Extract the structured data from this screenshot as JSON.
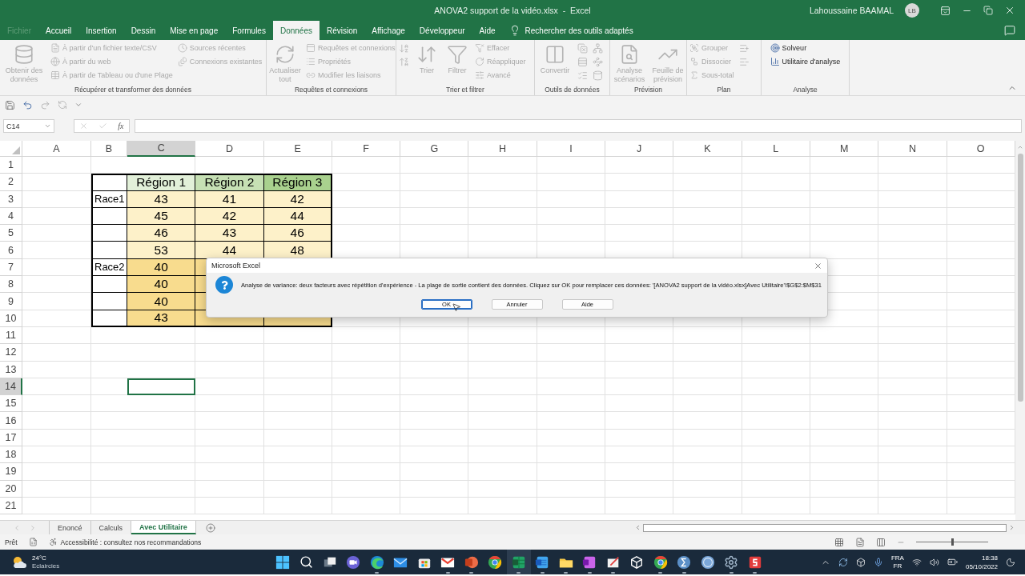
{
  "window": {
    "title": "ANOVA2 support de la vidéo.xlsx  -  Excel",
    "user": "Lahoussaine BAAMAL",
    "avatar": "LB"
  },
  "menu_tabs": [
    {
      "label": "Fichier",
      "selected": false,
      "disabled": true
    },
    {
      "label": "Accueil",
      "selected": false,
      "disabled": false
    },
    {
      "label": "Insertion",
      "selected": false,
      "disabled": false
    },
    {
      "label": "Dessin",
      "selected": false,
      "disabled": false
    },
    {
      "label": "Mise en page",
      "selected": false,
      "disabled": false
    },
    {
      "label": "Formules",
      "selected": false,
      "disabled": false
    },
    {
      "label": "Données",
      "selected": true,
      "disabled": false
    },
    {
      "label": "Révision",
      "selected": false,
      "disabled": false
    },
    {
      "label": "Affichage",
      "selected": false,
      "disabled": false
    },
    {
      "label": "Développeur",
      "selected": false,
      "disabled": false
    },
    {
      "label": "Aide",
      "selected": false,
      "disabled": false
    }
  ],
  "tell_me": "Rechercher des outils adaptés",
  "ribbon_groups": [
    {
      "title": "Récupérer et transformer des données",
      "columns": [
        {
          "kind": "large",
          "items": [
            {
              "label": "Obtenir des données",
              "disabled": true
            }
          ]
        },
        {
          "kind": "stack",
          "items": [
            {
              "label": "À partir d'un fichier texte/CSV",
              "disabled": true
            },
            {
              "label": "À partir du web",
              "disabled": true
            },
            {
              "label": "À partir de Tableau ou d'une Plage",
              "disabled": true
            }
          ]
        },
        {
          "kind": "stack",
          "items": [
            {
              "label": "Sources récentes",
              "disabled": true
            },
            {
              "label": "Connexions existantes",
              "disabled": true
            }
          ]
        }
      ]
    },
    {
      "title": "Requêtes et connexions",
      "columns": [
        {
          "kind": "large",
          "items": [
            {
              "label": "Actualiser tout",
              "disabled": true
            }
          ]
        },
        {
          "kind": "stack",
          "items": [
            {
              "label": "Requêtes et connexions",
              "disabled": true
            },
            {
              "label": "Propriétés",
              "disabled": true
            },
            {
              "label": "Modifier les liaisons",
              "disabled": true
            }
          ]
        }
      ]
    },
    {
      "title": "Trier et filtrer",
      "columns": [
        {
          "kind": "stack",
          "items": [
            {
              "disabled": true
            },
            {
              "disabled": true
            }
          ]
        },
        {
          "kind": "large",
          "items": [
            {
              "label": "Trier",
              "disabled": true
            }
          ]
        },
        {
          "kind": "large",
          "items": [
            {
              "label": "Filtrer",
              "disabled": true
            }
          ]
        },
        {
          "kind": "stack",
          "items": [
            {
              "label": "Effacer",
              "disabled": true
            },
            {
              "label": "Réappliquer",
              "disabled": true
            },
            {
              "label": "Avancé",
              "disabled": true
            }
          ]
        }
      ]
    },
    {
      "title": "Outils de données",
      "columns": [
        {
          "kind": "large",
          "items": [
            {
              "label": "Convertir",
              "disabled": true
            }
          ]
        },
        {
          "kind": "stack",
          "items": [
            {
              "disabled": true
            },
            {
              "disabled": true
            },
            {
              "disabled": true
            }
          ]
        },
        {
          "kind": "stack",
          "items": [
            {
              "disabled": true
            },
            {
              "disabled": true
            },
            {
              "disabled": true
            }
          ]
        }
      ]
    },
    {
      "title": "Prévision",
      "columns": [
        {
          "kind": "large",
          "items": [
            {
              "label": "Analyse scénarios",
              "disabled": true
            }
          ]
        },
        {
          "kind": "large",
          "items": [
            {
              "label": "Feuille de prévision",
              "disabled": true
            }
          ]
        }
      ]
    },
    {
      "title": "Plan",
      "columns": [
        {
          "kind": "stack",
          "items": [
            {
              "label": "Grouper",
              "disabled": true
            },
            {
              "label": "Dissocier",
              "disabled": true
            },
            {
              "label": "Sous-total",
              "disabled": true
            }
          ]
        },
        {
          "kind": "stack",
          "items": [
            {
              "disabled": true
            },
            {
              "disabled": true
            }
          ]
        }
      ]
    },
    {
      "title": "Analyse",
      "columns": [
        {
          "kind": "stack",
          "items": [
            {
              "label": "Solveur",
              "disabled": false
            },
            {
              "label": "Utilitaire d'analyse",
              "disabled": false
            }
          ]
        }
      ]
    }
  ],
  "formula_bar": {
    "name_box": "C14",
    "function_label": "fx"
  },
  "sheet": {
    "columns": [
      {
        "label": "A",
        "selected": false
      },
      {
        "label": "B",
        "selected": false
      },
      {
        "label": "C",
        "selected": true
      },
      {
        "label": "D",
        "selected": false
      },
      {
        "label": "E",
        "selected": false
      },
      {
        "label": "F",
        "selected": false
      },
      {
        "label": "G",
        "selected": false
      },
      {
        "label": "H",
        "selected": false
      },
      {
        "label": "I",
        "selected": false
      },
      {
        "label": "J",
        "selected": false
      },
      {
        "label": "K",
        "selected": false
      },
      {
        "label": "L",
        "selected": false
      },
      {
        "label": "M",
        "selected": false
      },
      {
        "label": "N",
        "selected": false
      },
      {
        "label": "O",
        "selected": false
      }
    ],
    "rows": [
      {
        "label": "1",
        "selected": false
      },
      {
        "label": "2",
        "selected": false
      },
      {
        "label": "3",
        "selected": false
      },
      {
        "label": "4",
        "selected": false
      },
      {
        "label": "5",
        "selected": false
      },
      {
        "label": "6",
        "selected": false
      },
      {
        "label": "7",
        "selected": false
      },
      {
        "label": "8",
        "selected": false
      },
      {
        "label": "9",
        "selected": false
      },
      {
        "label": "10",
        "selected": false
      },
      {
        "label": "11",
        "selected": false
      },
      {
        "label": "12",
        "selected": false
      },
      {
        "label": "13",
        "selected": false
      },
      {
        "label": "14",
        "selected": true
      },
      {
        "label": "15",
        "selected": false
      },
      {
        "label": "16",
        "selected": false
      },
      {
        "label": "17",
        "selected": false
      },
      {
        "label": "18",
        "selected": false
      },
      {
        "label": "19",
        "selected": false
      },
      {
        "label": "20",
        "selected": false
      },
      {
        "label": "21",
        "selected": false
      }
    ],
    "table": {
      "headers": [
        {
          "text": "Région 1",
          "color": "#e2f0d9"
        },
        {
          "text": "Région 2",
          "color": "#c6e0b4"
        },
        {
          "text": "Région 3",
          "color": "#a9d18e"
        }
      ],
      "rows": [
        {
          "label": "Race1",
          "color": "#fdf1c9",
          "values": [
            "43",
            "41",
            "42"
          ]
        },
        {
          "color": "#fdf1c9",
          "values": [
            "45",
            "42",
            "44"
          ]
        },
        {
          "color": "#fdf1c9",
          "values": [
            "46",
            "43",
            "46"
          ]
        },
        {
          "color": "#fdf1c9",
          "values": [
            "53",
            "44",
            "48"
          ]
        },
        {
          "label": "Race2",
          "color": "#f8dc8e",
          "values": [
            "40"
          ]
        },
        {
          "color": "#f8dc8e",
          "values": [
            "40"
          ]
        },
        {
          "color": "#f8dc8e",
          "values": [
            "40"
          ]
        },
        {
          "color": "#f8dc8e",
          "values": [
            "43"
          ]
        }
      ]
    }
  },
  "dialog": {
    "title": "Microsoft Excel",
    "message": "Analyse de variance: deux facteurs avec répétition d'expérience - La plage de sortie contient des données. Cliquez sur OK pour remplacer ces données: '[ANOVA2 support de la vidéo.xlsx]Avec Utilitaire'!$G$2:$M$31",
    "buttons": [
      {
        "label": "OK",
        "selected": true
      },
      {
        "label": "Annuler",
        "selected": false
      },
      {
        "label": "Aide",
        "selected": false
      }
    ]
  },
  "sheet_tabs": [
    {
      "label": "Enoncé",
      "selected": false
    },
    {
      "label": "Calculs",
      "selected": false
    },
    {
      "label": "Avec Utilitaire",
      "selected": true
    }
  ],
  "status_bar": {
    "ready": "Prêt",
    "accessibility": "Accessibilité : consultez nos recommandations",
    "zoom": {
      "level": 0.5
    }
  },
  "taskbar": {
    "weather": {
      "temperature": "24°C",
      "condition": "Eclaircies"
    },
    "apps": [
      {
        "kind": "start",
        "open": false
      },
      {
        "kind": "search",
        "open": false
      },
      {
        "kind": "taskview",
        "open": false
      },
      {
        "kind": "chat",
        "open": false
      },
      {
        "kind": "edge",
        "open": true
      },
      {
        "kind": "mail",
        "open": false
      },
      {
        "kind": "store",
        "open": false
      },
      {
        "kind": "gmail",
        "open": true
      },
      {
        "kind": "powerpoint",
        "open": true
      },
      {
        "kind": "chrome",
        "open": false
      },
      {
        "kind": "excel",
        "open": true
      },
      {
        "kind": "word",
        "open": true
      },
      {
        "kind": "explorer",
        "open": true
      },
      {
        "kind": "onenote",
        "open": true
      },
      {
        "kind": "snip",
        "open": true
      },
      {
        "kind": "cube",
        "open": false
      },
      {
        "kind": "chrome",
        "open": true
      },
      {
        "kind": "sigma",
        "open": true
      },
      {
        "kind": "r",
        "open": false
      },
      {
        "kind": "settings",
        "open": true
      },
      {
        "kind": "s",
        "open": true
      }
    ],
    "input_language": "FRA",
    "keyboard_layout": "FR",
    "time": "18:38",
    "date": "05/10/2022"
  }
}
